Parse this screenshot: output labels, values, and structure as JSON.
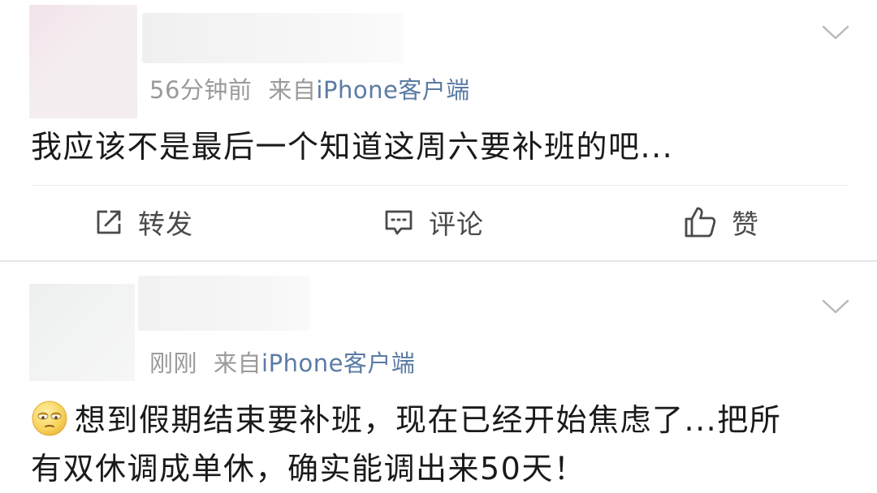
{
  "posts": [
    {
      "time": "56分钟前",
      "from_label": "来自",
      "client": "iPhone客户端",
      "text": "我应该不是最后一个知道这周六要补班的吧...",
      "actions": {
        "repost": "转发",
        "comment": "评论",
        "like": "赞"
      }
    },
    {
      "time": "刚刚",
      "from_label": "来自",
      "client": "iPhone客户端",
      "text_line1": "想到假期结束要补班，现在已经开始焦虑了...把所",
      "text_line2": "有双休调成单休，确实能调出来50天！"
    }
  ],
  "colors": {
    "meta_gray": "#9a9a9a",
    "client_blue": "#5b7ba4",
    "text": "#1a1a1a",
    "action_text": "#4a4a4a",
    "divider": "#e6e6e6"
  },
  "icons": {
    "more": "chevron-down-icon",
    "repost": "share-arrow-icon",
    "comment": "comment-bubble-icon",
    "like": "thumbs-up-icon",
    "emoji": "eye-roll-emoji"
  }
}
